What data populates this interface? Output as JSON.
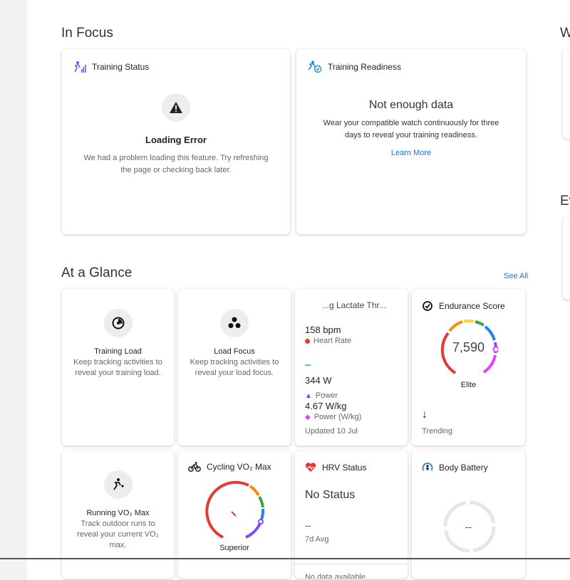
{
  "in_focus": {
    "title": "In Focus",
    "training_status": {
      "title": "Training Status",
      "error_title": "Loading Error",
      "error_message": "We had a problem loading this feature. Try refreshing the page or checking back later."
    },
    "training_readiness": {
      "title": "Training Readiness",
      "heading": "Not enough data",
      "message": "Wear your compatible watch continuously for three days to reveal your training readiness.",
      "link": "Learn More"
    }
  },
  "right_partial": {
    "title_top": "W",
    "title_mid": "Ev"
  },
  "at_a_glance": {
    "title": "At a Glance",
    "see_all": "See All",
    "training_load": {
      "label": "Training Load",
      "desc": "Keep tracking activities to reveal your training load."
    },
    "load_focus": {
      "label": "Load Focus",
      "desc": "Keep tracking activities to reveal your load focus."
    },
    "lactate": {
      "title": "...g Lactate Thr...",
      "hr_value": "158 bpm",
      "hr_label": "Heart Rate",
      "power_value": "344 W",
      "power_label": "Power",
      "wkg_value": "4.67 W/kg",
      "wkg_label": "Power (W/kg)",
      "updated": "Updated 10 Jul"
    },
    "endurance": {
      "title": "Endurance Score",
      "value": "7,590",
      "level": "Elite",
      "trend_label": "Trending",
      "colors": [
        "#e53935",
        "#fb8c00",
        "#fdd835",
        "#43a047",
        "#1e88e5",
        "#7c4dff",
        "#e040fb"
      ]
    },
    "running_vo2": {
      "label": "Running VO₂ Max",
      "desc": "Track outdoor runs to reveal your current VO₂ max."
    },
    "cycling_vo2": {
      "title": "Cycling VO₂ Max",
      "level": "Superior"
    },
    "hrv": {
      "title": "HRV Status",
      "status": "No Status",
      "value": "--",
      "avg_label": "7d Avg",
      "footer": "No data available"
    },
    "body_battery": {
      "title": "Body Battery",
      "value": "--"
    }
  }
}
